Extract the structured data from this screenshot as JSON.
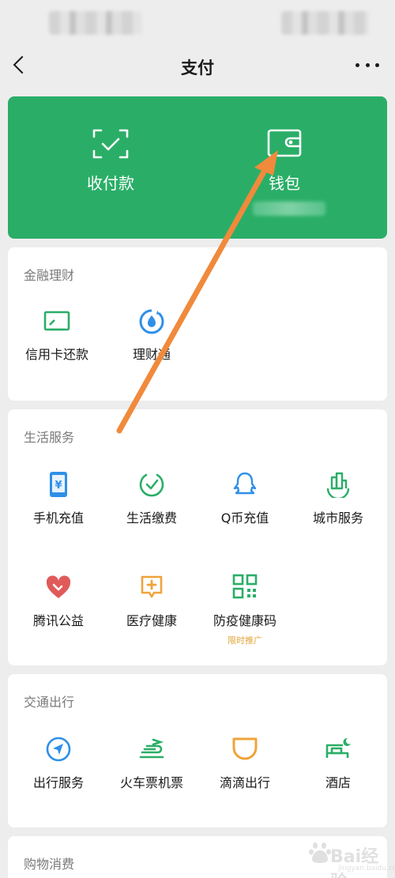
{
  "nav": {
    "title": "支付"
  },
  "hero": {
    "pay_label": "收付款",
    "wallet_label": "钱包",
    "color": "#2aae67"
  },
  "finance": {
    "title": "金融理财",
    "items": [
      {
        "label": "信用卡还款",
        "icon": "credit-card-icon"
      },
      {
        "label": "理财通",
        "icon": "wealth-icon"
      }
    ]
  },
  "life": {
    "title": "生活服务",
    "items": [
      {
        "label": "手机充值",
        "icon": "phone-topup-icon"
      },
      {
        "label": "生活缴费",
        "icon": "utility-bills-icon"
      },
      {
        "label": "Q币充值",
        "icon": "qq-coin-icon"
      },
      {
        "label": "城市服务",
        "icon": "city-services-icon"
      },
      {
        "label": "腾讯公益",
        "icon": "charity-icon"
      },
      {
        "label": "医疗健康",
        "icon": "medical-icon"
      },
      {
        "label": "防疫健康码",
        "icon": "health-code-icon",
        "tag": "限时推广"
      }
    ]
  },
  "transport": {
    "title": "交通出行",
    "items": [
      {
        "label": "出行服务",
        "icon": "travel-services-icon"
      },
      {
        "label": "火车票机票",
        "icon": "train-plane-icon"
      },
      {
        "label": "滴滴出行",
        "icon": "didi-icon"
      },
      {
        "label": "酒店",
        "icon": "hotel-icon"
      }
    ]
  },
  "shopping": {
    "title": "购物消费"
  },
  "colors": {
    "accent": "#2aae67",
    "blue": "#2f8fe8",
    "red": "#e15a5a",
    "orange": "#f0a33b",
    "tag": "#e0a63a",
    "arrow": "#f08a3c"
  }
}
